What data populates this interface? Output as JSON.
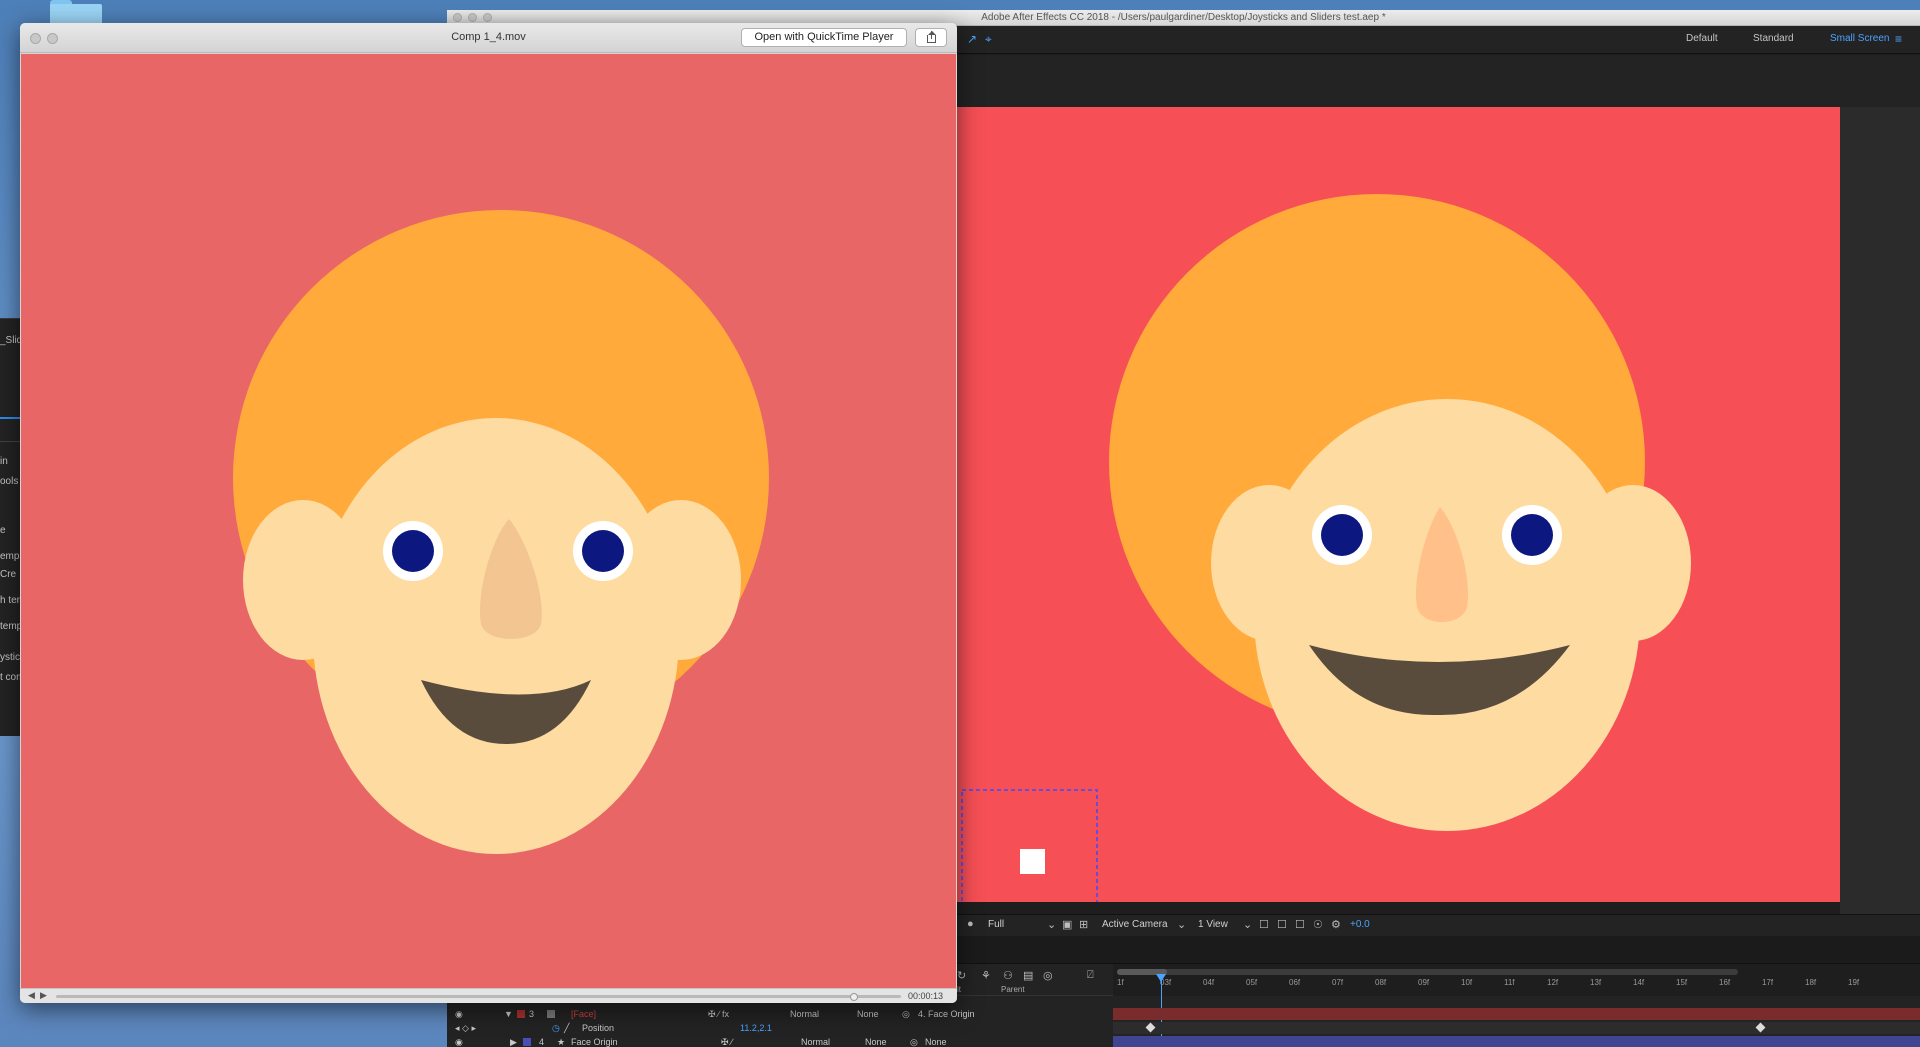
{
  "qt": {
    "title": "Comp 1_4.mov",
    "open_button": "Open with QuickTime Player",
    "time": "00:00:13"
  },
  "ae": {
    "title": "Adobe After Effects CC 2018 - /Users/paulgardiner/Desktop/Joysticks and Sliders test.aep *",
    "workspaces": [
      "Default",
      "Standard",
      "Small Screen"
    ],
    "active_workspace": "Small Screen"
  },
  "viewer_bar": {
    "resolution": "Full",
    "camera": "Active Camera",
    "views": "1 View",
    "exposure": "+0.0"
  },
  "timeline": {
    "ticks": [
      "1f",
      "03f",
      "04f",
      "05f",
      "06f",
      "07f",
      "08f",
      "09f",
      "10f",
      "11f",
      "12f",
      "13f",
      "14f",
      "15f",
      "16f",
      "17f",
      "18f",
      "19f"
    ],
    "header_fragment": "it",
    "header_parent": "Parent",
    "rows": [
      {
        "num": "3",
        "name": "[Face]",
        "mode": "Normal",
        "trkmat": "None",
        "parent": "4. Face Origin",
        "color": "#a8302e"
      },
      {
        "name": "Position",
        "value": "11.2,2.1"
      },
      {
        "num": "4",
        "name": "Face Origin",
        "mode": "Normal",
        "trkmat": "None",
        "parent": "None",
        "color": "#4a4fb5"
      }
    ]
  },
  "left_panel_fragments": [
    "_Slid",
    "in",
    "ools",
    "e",
    "empl",
    "Cre",
    "h ter",
    "temp",
    "ystic",
    "t com"
  ],
  "colors": {
    "qt_bg": "#e86666",
    "ae_bg": "#f64f56",
    "hair": "#ffaa3a",
    "skin": "#fedba1",
    "nose_qt": "#f2c591",
    "nose_ae": "#ffc08a",
    "pupil": "#0c1780",
    "mouth": "#5a4c3d",
    "accent": "#4aa3ff"
  }
}
